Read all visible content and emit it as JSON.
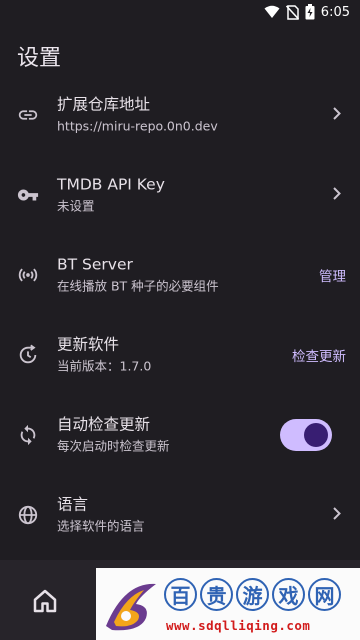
{
  "status_bar": {
    "time": "6:05"
  },
  "page": {
    "title": "设置"
  },
  "rows": [
    {
      "icon": "link-icon",
      "title": "扩展仓库地址",
      "subtitle": "https://miru-repo.0n0.dev",
      "trailing": "chevron-right-icon"
    },
    {
      "icon": "key-icon",
      "title": "TMDB API Key",
      "subtitle": "未设置",
      "trailing": "chevron-right-icon"
    },
    {
      "icon": "broadcast-icon",
      "title": "BT Server",
      "subtitle": "在线播放 BT 种子的必要组件",
      "action": "管理"
    },
    {
      "icon": "update-icon",
      "title": "更新软件",
      "subtitle": "当前版本：1.7.0",
      "action": "检查更新"
    },
    {
      "icon": "sync-icon",
      "title": "自动检查更新",
      "subtitle": "每次启动时检查更新",
      "toggle": true
    },
    {
      "icon": "globe-icon",
      "title": "语言",
      "subtitle": "选择软件的语言",
      "trailing": "chevron-right-icon"
    }
  ],
  "bottom_nav": {
    "items": [
      {
        "icon": "home-icon"
      }
    ]
  },
  "watermark": {
    "chars": [
      "百",
      "贵",
      "游",
      "戏",
      "网"
    ],
    "url": "www.sdqlliqing.com"
  },
  "colors": {
    "background": "#1f1d22",
    "accent": "#cfbcff",
    "toggle_knob": "#381e72"
  }
}
